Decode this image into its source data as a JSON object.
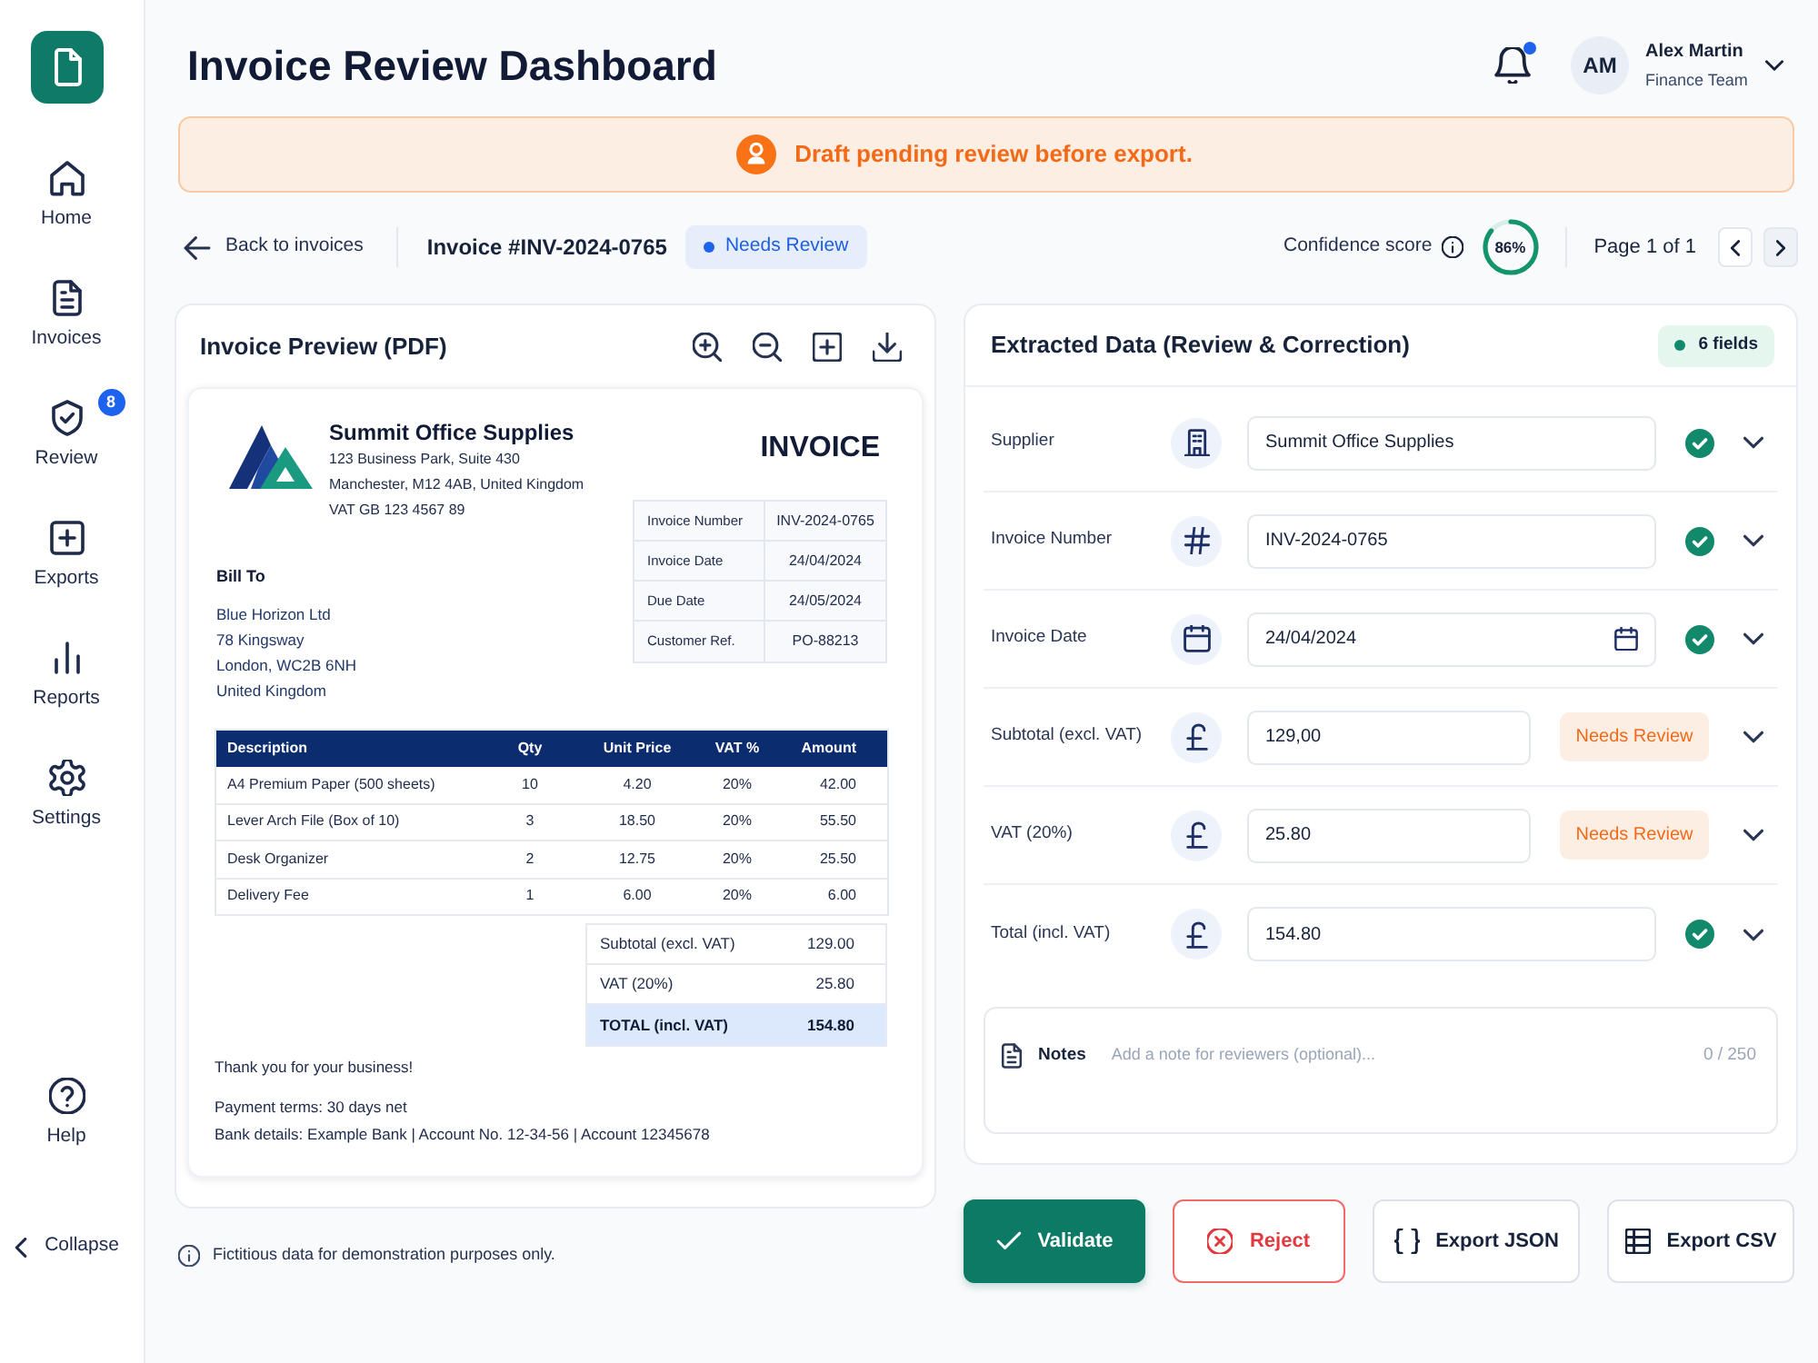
{
  "sidebar": {
    "items": [
      {
        "label": "Home",
        "selected": false
      },
      {
        "label": "Invoices",
        "selected": false
      },
      {
        "label": "Review",
        "selected": false,
        "badge": "8"
      },
      {
        "label": "Exports",
        "selected": false
      },
      {
        "label": "Reports",
        "selected": false
      },
      {
        "label": "Settings",
        "selected": false
      }
    ],
    "help": {
      "label": "Help"
    },
    "collapse": {
      "label": "Collapse"
    }
  },
  "header": {
    "title": "Invoice Review Dashboard",
    "notifications": {
      "unread": true
    },
    "user": {
      "initials": "AM",
      "name": "Alex Martin",
      "role": "Finance Team"
    }
  },
  "banner": {
    "message": "Draft pending review before export."
  },
  "toolbar": {
    "back_link": "Back to invoices",
    "invoice_number": "Invoice #INV-2024-0765",
    "status_badge": "Needs Review",
    "confidence": {
      "label": "Confidence score",
      "level": 0.86,
      "reading": "86%"
    },
    "pager": {
      "label": "Page 1 of 1"
    }
  },
  "preview": {
    "title": "Invoice Preview (PDF)",
    "document": {
      "supplier": {
        "name": "Summit Office Supplies",
        "address": [
          "123 Business Park, Suite 430",
          "Manchester, M12 4AB, United Kingdom",
          "VAT GB 123 4567 89"
        ]
      },
      "title": "INVOICE",
      "meta": [
        {
          "label": "Invoice Number",
          "value": "INV-2024-0765"
        },
        {
          "label": "Invoice Date",
          "value": "24/04/2024"
        },
        {
          "label": "Due Date",
          "value": "24/05/2024"
        },
        {
          "label": "Customer Ref.",
          "value": "PO-88213"
        }
      ],
      "bill_to": {
        "heading": "Bill To",
        "lines": [
          "Blue Horizon Ltd",
          "78 Kingsway",
          "London, WC2B 6NH",
          "United Kingdom"
        ]
      },
      "items": {
        "columns": [
          "Description",
          "Qty",
          "Unit Price",
          "VAT %",
          "Amount"
        ],
        "rows": [
          [
            "A4 Premium Paper (500 sheets)",
            "10",
            "4.20",
            "20%",
            "42.00"
          ],
          [
            "Lever Arch File (Box of 10)",
            "3",
            "18.50",
            "20%",
            "55.50"
          ],
          [
            "Desk Organizer",
            "2",
            "12.75",
            "20%",
            "25.50"
          ],
          [
            "Delivery Fee",
            "1",
            "6.00",
            "20%",
            "6.00"
          ]
        ]
      },
      "totals": [
        {
          "label": "Subtotal (excl. VAT)",
          "value": "129.00",
          "highlighted": false
        },
        {
          "label": "VAT (20%)",
          "value": "25.80",
          "highlighted": false
        },
        {
          "label": "TOTAL (incl. VAT)",
          "value": "154.80",
          "highlighted": true
        }
      ],
      "thank_you": "Thank you for your business!",
      "terms": [
        "Payment terms: 30 days net",
        "Bank details: Example Bank | Account No. 12-34-56 | Account 12345678"
      ]
    }
  },
  "footnote": "Fictitious data for demonstration purposes only.",
  "extracted": {
    "title": "Extracted Data (Review & Correction)",
    "count_badge": "6 fields",
    "fields": [
      {
        "label": "Supplier",
        "kind": "name",
        "value": "Summit Office Supplies",
        "needs_review": false
      },
      {
        "label": "Invoice Number",
        "kind": "id",
        "value": "INV-2024-0765",
        "needs_review": false
      },
      {
        "label": "Invoice Date",
        "kind": "date",
        "value": "24/04/2024",
        "needs_review": false
      },
      {
        "label": "Subtotal (excl. VAT)",
        "kind": "money",
        "value": "129,00",
        "needs_review": true,
        "badge": "Needs Review"
      },
      {
        "label": "VAT (20%)",
        "kind": "money",
        "value": "25.80",
        "needs_review": true,
        "badge": "Needs Review"
      },
      {
        "label": "Total (incl. VAT)",
        "kind": "money",
        "value": "154.80",
        "needs_review": false
      }
    ],
    "notes": {
      "label": "Notes",
      "placeholder": "Add a note for reviewers (optional)...",
      "counter": "0 / 250"
    }
  },
  "actions": [
    {
      "label": "Validate",
      "kind": "primary"
    },
    {
      "label": "Reject",
      "kind": "danger"
    },
    {
      "label": "Export JSON",
      "kind": "secondary"
    },
    {
      "label": "Export CSV",
      "kind": "secondary"
    }
  ]
}
